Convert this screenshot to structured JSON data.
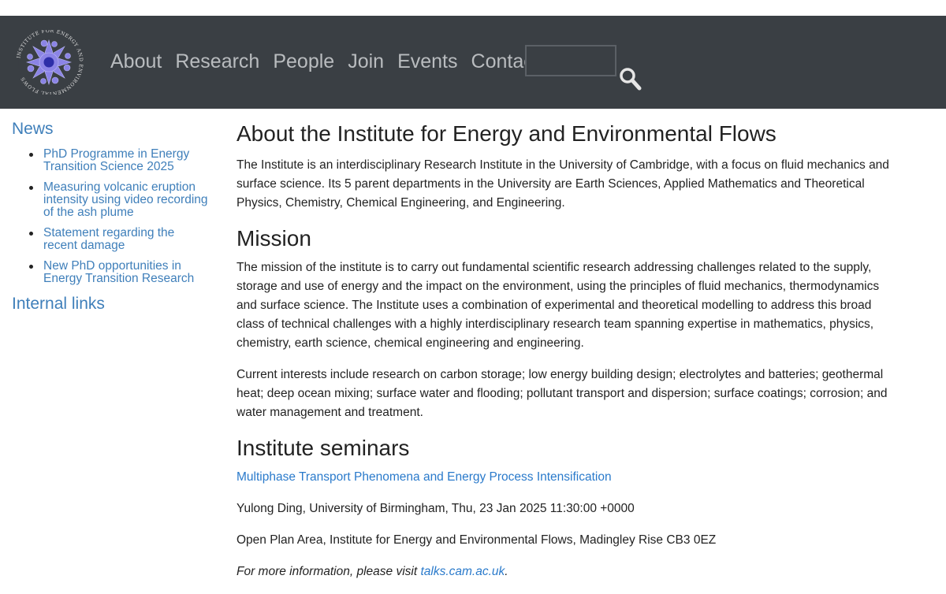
{
  "header": {
    "nav": [
      "About",
      "Research",
      "People",
      "Join",
      "Events",
      "Contact"
    ],
    "search_value": "",
    "logo_text": "INSTITUTE FOR ENERGY AND ENVIRONMENTAL FLOWS"
  },
  "sidebar": {
    "news_heading": "News",
    "news_items": [
      [
        "PhD Programme in Energy",
        "Transition Science 2025"
      ],
      [
        "Measuring volcanic eruption",
        "intensity using video recording",
        "of the ash plume"
      ],
      [
        "Statement regarding the",
        "recent damage"
      ],
      [
        "New PhD opportunities in",
        "Energy Transition Research"
      ]
    ],
    "internal_links_heading": "Internal links"
  },
  "main": {
    "about_heading": "About the Institute for Energy and Environmental Flows",
    "about_text": "The Institute is an interdisciplinary Research Institute in the University of Cambridge, with a focus on fluid mechanics and surface science. Its 5 parent departments in the University are Earth Sciences, Applied Mathematics and Theoretical Physics, Chemistry, Chemical Engineering, and Engineering.",
    "mission_heading": "Mission",
    "mission_text": "The mission of the institute is to carry out fundamental scientific research addressing challenges related to the supply, storage and use of energy and the impact on the environment, using the principles of fluid mechanics, thermodynamics and surface science. The Institute uses a combination of experimental and theoretical modelling to address this broad class of technical challenges with a highly interdisciplinary research team spanning expertise in mathematics, physics, chemistry, earth science, chemical engineering and engineering.",
    "interests_text": "Current interests include research on carbon storage; low energy building design; electrolytes and batteries; geothermal heat; deep ocean mixing; surface water and flooding; pollutant transport and dispersion; surface coatings; corrosion; and water management and treatment.",
    "seminars_heading": "Institute seminars",
    "seminar_title": "Multiphase Transport Phenomena and Energy Process Intensification",
    "seminar_speaker": "Yulong Ding, University of Birmingham, Thu, 23 Jan 2025 11:30:00 +0000",
    "seminar_location": "Open Plan Area, Institute for Energy and Environmental Flows, Madingley Rise CB3 0EZ",
    "more_info_prefix": "For more information, please visit ",
    "more_info_link": "talks.cam.ac.uk",
    "more_info_suffix": "."
  },
  "colors": {
    "header_bg": "#3a3f44",
    "nav_text": "#b9bcbf",
    "link_blue": "#3f7fba",
    "seminar_link": "#2a7acb",
    "logo_purple": "#8b84e6",
    "logo_center": "#2d2ea8"
  },
  "icons": {
    "search": "magnifier-icon",
    "logo": "snowflake-logo"
  }
}
